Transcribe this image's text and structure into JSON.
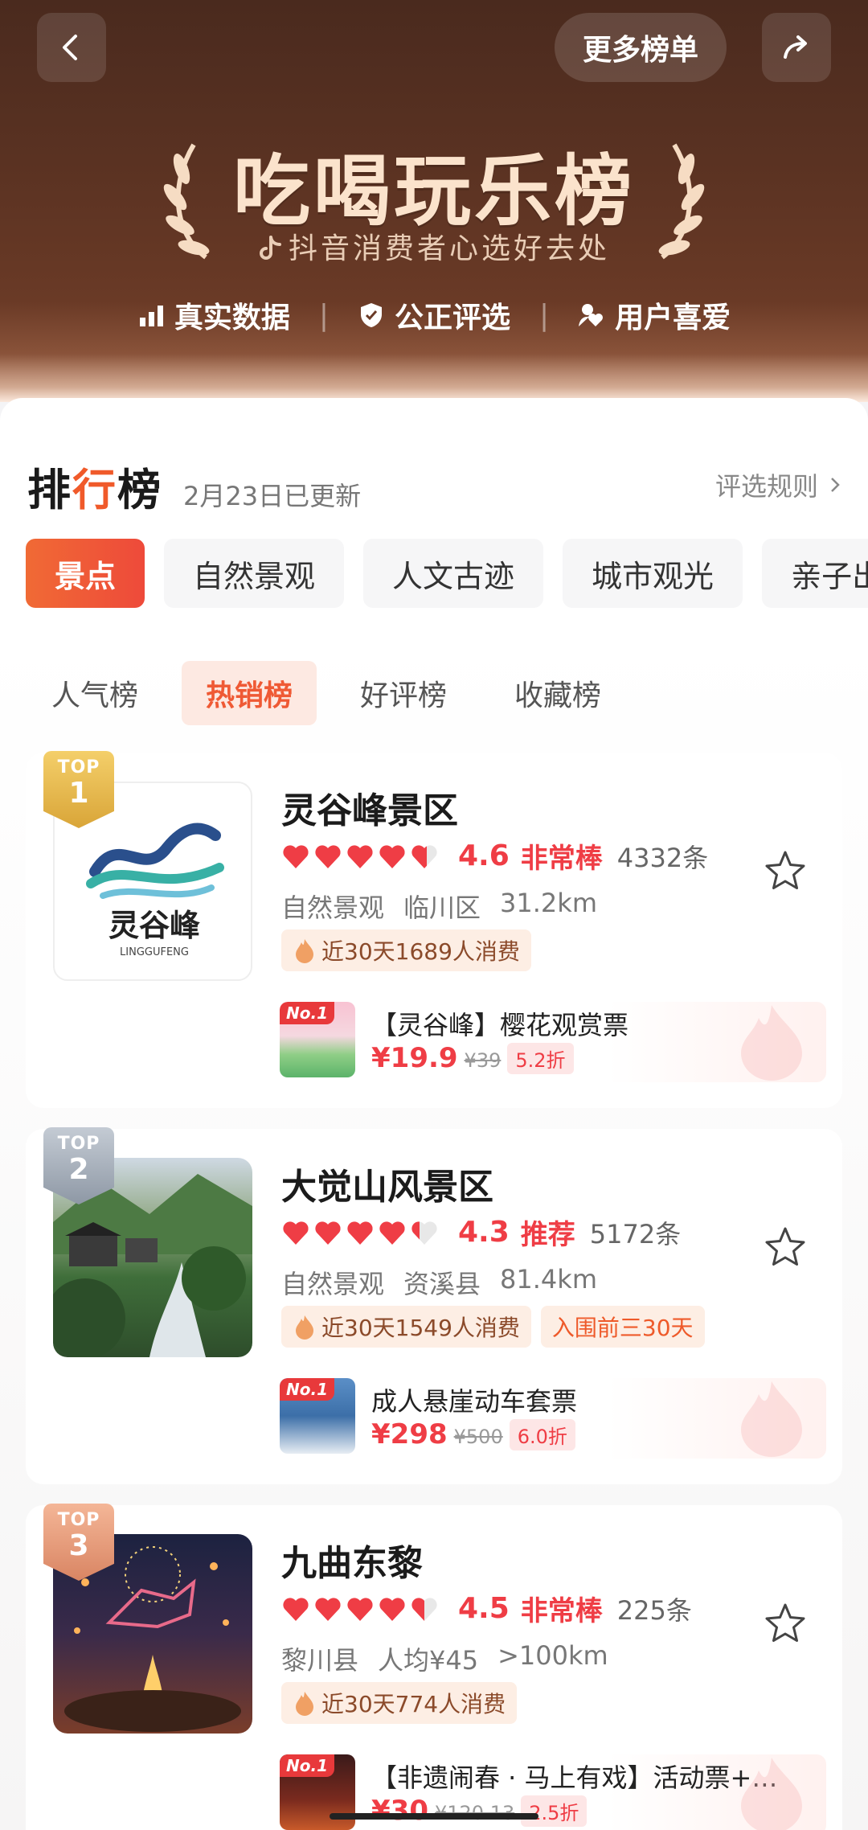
{
  "header": {
    "more_lists": "更多榜单",
    "title": "吃喝玩乐榜",
    "subtitle": "抖音消费者心选好去处",
    "features": [
      "真实数据",
      "公正评选",
      "用户喜爱"
    ]
  },
  "ranking": {
    "title_left": "排",
    "title_accent": "行",
    "title_right": "榜",
    "updated": "2月23日已更新",
    "rules": "评选规则"
  },
  "category_tabs": [
    "景点",
    "自然景观",
    "人文古迹",
    "城市观光",
    "亲子出"
  ],
  "sub_tabs": [
    "人气榜",
    "热销榜",
    "好评榜",
    "收藏榜"
  ],
  "items": [
    {
      "rank": "1",
      "top_label": "TOP",
      "name": "灵谷峰景区",
      "hearts": 4.6,
      "score": "4.6",
      "verdict": "非常棒",
      "reviews": "4332条",
      "meta": [
        "自然景观",
        "临川区",
        "31.2km"
      ],
      "tags": [
        "近30天1689人消费"
      ],
      "logo_text": "灵谷峰",
      "logo_sub": "LINGGUFENG",
      "deal": {
        "badge": "No.1",
        "title": "【灵谷峰】樱花观赏票",
        "price": "¥19.9",
        "old": "¥39",
        "discount": "5.2折"
      }
    },
    {
      "rank": "2",
      "top_label": "TOP",
      "name": "大觉山风景区",
      "hearts": 4.3,
      "score": "4.3",
      "verdict": "推荐",
      "reviews": "5172条",
      "meta": [
        "自然景观",
        "资溪县",
        "81.4km"
      ],
      "tags": [
        "近30天1549人消费",
        "入围前三30天"
      ],
      "deal": {
        "badge": "No.1",
        "title": "成人悬崖动车套票",
        "price": "¥298",
        "old": "¥500",
        "discount": "6.0折"
      }
    },
    {
      "rank": "3",
      "top_label": "TOP",
      "name": "九曲东黎",
      "hearts": 4.5,
      "score": "4.5",
      "verdict": "非常棒",
      "reviews": "225条",
      "meta": [
        "黎川县",
        "人均¥45",
        ">100km"
      ],
      "tags": [
        "近30天774人消费"
      ],
      "deal": {
        "badge": "No.1",
        "title": "【非遗闹春 · 马上有戏】活动票+…",
        "price": "¥30",
        "old": "¥120.13",
        "discount": "2.5折"
      }
    }
  ],
  "colors": {
    "accent": "#ef3d45",
    "tab_active": "#f06a35",
    "hero_bg": "#5a3222"
  }
}
